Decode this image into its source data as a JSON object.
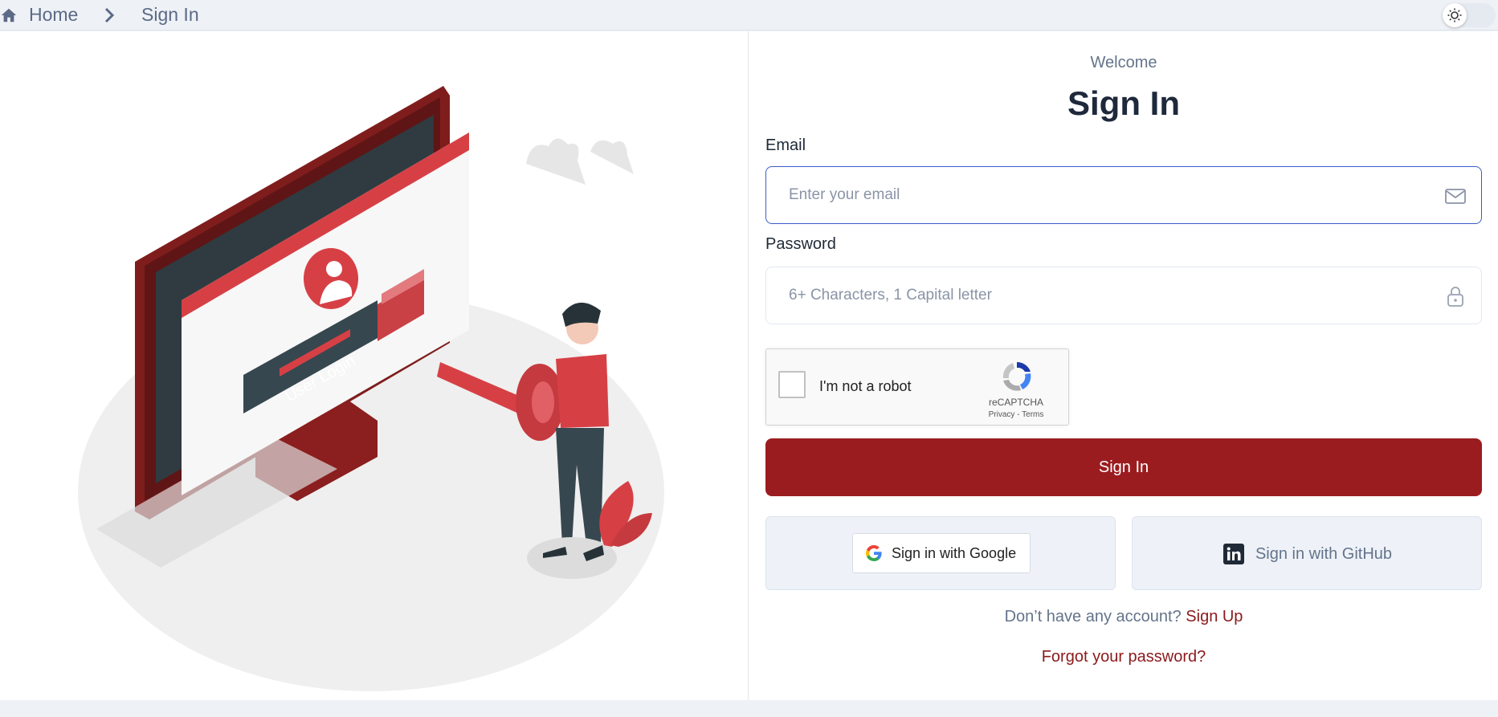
{
  "breadcrumb": {
    "home_icon": "home-icon",
    "home_label": "Home",
    "separator_icon": "chevron-right-icon",
    "current_label": "Sign In"
  },
  "theme_toggle": {
    "icon": "sun-icon"
  },
  "illustration": {
    "screen_text": "User Login"
  },
  "form": {
    "welcome": "Welcome",
    "title": "Sign In",
    "email_label": "Email",
    "email_placeholder": "Enter your email",
    "email_icon": "mail-icon",
    "password_label": "Password",
    "password_placeholder": "6+ Characters, 1 Capital letter",
    "password_icon": "lock-icon",
    "captcha_label": "I'm not a robot",
    "captcha_brand": "reCAPTCHA",
    "captcha_links": "Privacy - Terms",
    "submit_label": "Sign In",
    "google_label": "Sign in with Google",
    "github_label": "Sign in with GitHub",
    "no_account_text": "Don’t have any account?",
    "signup_link": "Sign Up",
    "forgot_link": "Forgot your password?"
  },
  "colors": {
    "primary": "#9b1c1f",
    "link": "#8b1a1c",
    "focus_border": "#3b5bcc"
  }
}
